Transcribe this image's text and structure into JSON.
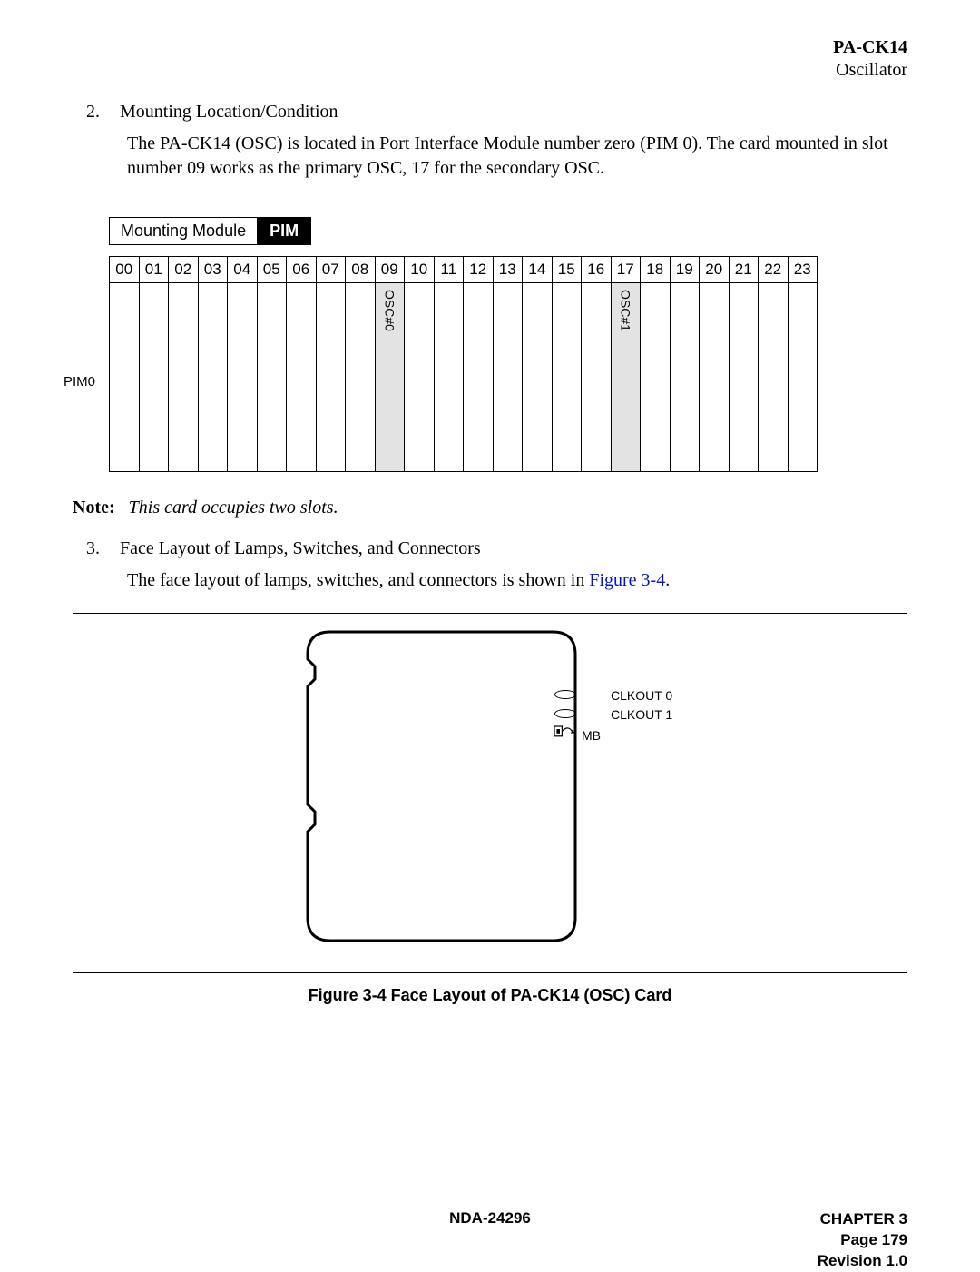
{
  "header": {
    "code": "PA-CK14",
    "subtitle": "Oscillator"
  },
  "section2": {
    "num": "2.",
    "title": "Mounting Location/Condition",
    "para": "The PA-CK14 (OSC) is located in Port Interface Module number zero (PIM 0). The card mounted in slot number 09 works as the primary OSC, 17 for the secondary OSC."
  },
  "mount": {
    "label": "Mounting Module",
    "badge": "PIM",
    "row_label": "PIM0"
  },
  "slots": {
    "headers": [
      "00",
      "01",
      "02",
      "03",
      "04",
      "05",
      "06",
      "07",
      "08",
      "09",
      "10",
      "11",
      "12",
      "13",
      "14",
      "15",
      "16",
      "17",
      "18",
      "19",
      "20",
      "21",
      "22",
      "23"
    ],
    "highlight": {
      "9": "OSC#0",
      "17": "OSC#1"
    }
  },
  "note": {
    "label": "Note:",
    "text": "This card occupies two slots."
  },
  "section3": {
    "num": "3.",
    "title": "Face Layout of Lamps, Switches, and Connectors",
    "para_pre": "The face layout of lamps, switches, and connectors is shown in ",
    "link": "Figure 3-4",
    "para_post": "."
  },
  "figure": {
    "caption": "Figure 3-4   Face Layout of PA-CK14 (OSC) Card",
    "labels": {
      "clk0": "CLKOUT 0",
      "clk1": "CLKOUT 1",
      "mb": "MB"
    }
  },
  "footer": {
    "center": "NDA-24296",
    "chapter": "CHAPTER 3",
    "page": "Page 179",
    "rev": "Revision 1.0"
  }
}
